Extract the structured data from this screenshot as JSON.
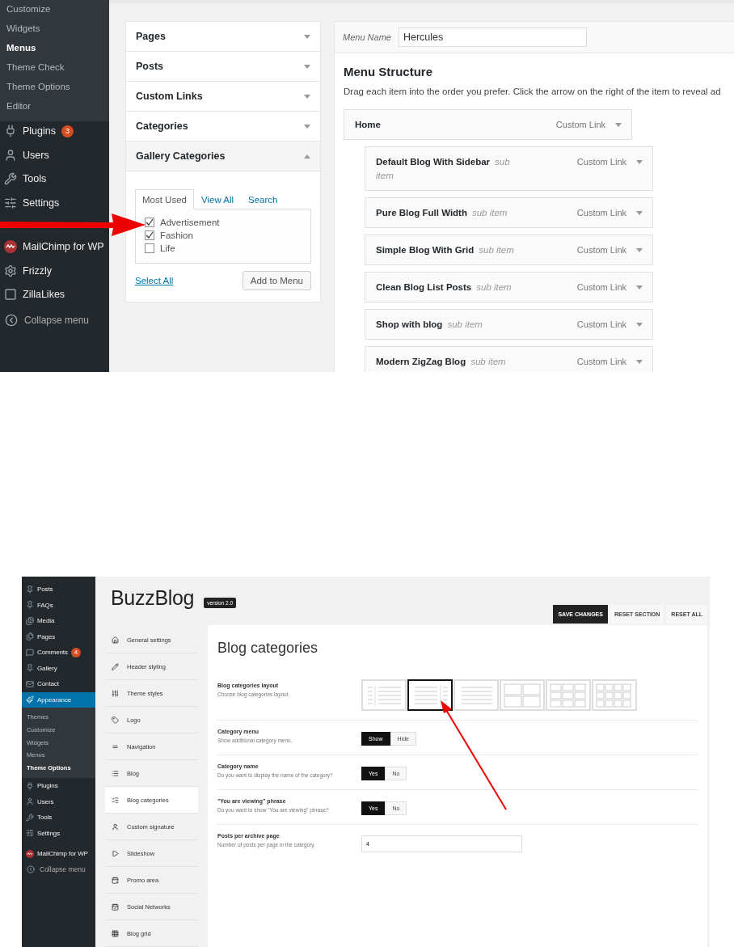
{
  "menus_screen": {
    "sidebar": {
      "submenu": [
        {
          "label": "Customize",
          "selected": false
        },
        {
          "label": "Widgets",
          "selected": false
        },
        {
          "label": "Menus",
          "selected": true
        },
        {
          "label": "Theme Check",
          "selected": false
        },
        {
          "label": "Theme Options",
          "selected": false
        },
        {
          "label": "Editor",
          "selected": false
        }
      ],
      "items": [
        {
          "label": "Plugins",
          "badge": "3"
        },
        {
          "label": "Users"
        },
        {
          "label": "Tools"
        },
        {
          "label": "Settings"
        },
        {
          "label": "MailChimp for WP"
        },
        {
          "label": "Frizzly"
        },
        {
          "label": "ZillaLikes"
        }
      ],
      "collapse": "Collapse menu"
    },
    "accordion": [
      {
        "title": "Pages",
        "expanded": false
      },
      {
        "title": "Posts",
        "expanded": false
      },
      {
        "title": "Custom Links",
        "expanded": false
      },
      {
        "title": "Categories",
        "expanded": false
      },
      {
        "title": "Gallery Categories",
        "expanded": true,
        "tabs": [
          {
            "label": "Most Used",
            "selected": true
          },
          {
            "label": "View All",
            "selected": false
          },
          {
            "label": "Search",
            "selected": false
          }
        ],
        "checklist": [
          {
            "label": "Advertisement",
            "checked": true
          },
          {
            "label": "Fashion",
            "checked": true
          },
          {
            "label": "Life",
            "checked": false
          }
        ],
        "select_all": "Select All",
        "add_button": "Add to Menu"
      }
    ],
    "menu_name": {
      "label": "Menu Name",
      "value": "Hercules"
    },
    "structure": {
      "title": "Menu Structure",
      "hint": "Drag each item into the order you prefer. Click the arrow on the right of the item to reveal ad",
      "items": [
        {
          "title": "Home",
          "type": "Custom Link",
          "children": [
            {
              "title": "Default Blog With Sidebar",
              "note": "sub item",
              "type": "Custom Link"
            },
            {
              "title": "Pure Blog Full Width",
              "note": "sub item",
              "type": "Custom Link"
            },
            {
              "title": "Simple Blog With Grid",
              "note": "sub item",
              "type": "Custom Link"
            },
            {
              "title": "Clean Blog List Posts",
              "note": "sub item",
              "type": "Custom Link"
            },
            {
              "title": "Shop with blog",
              "note": "sub item",
              "type": "Custom Link"
            },
            {
              "title": "Modern ZigZag Blog",
              "note": "sub item",
              "type": "Custom Link"
            }
          ]
        }
      ]
    }
  },
  "theme_options_screen": {
    "sidebar": {
      "items": [
        {
          "label": "Posts",
          "selected": false
        },
        {
          "label": "FAQs",
          "selected": false
        },
        {
          "label": "Media",
          "selected": false
        },
        {
          "label": "Pages",
          "selected": false
        },
        {
          "label": "Comments",
          "badge": "4",
          "selected": false
        },
        {
          "label": "Gallery",
          "selected": false
        },
        {
          "label": "Contact",
          "selected": false
        },
        {
          "label": "Appearance",
          "selected": true,
          "children": [
            {
              "label": "Themes",
              "selected": false
            },
            {
              "label": "Customize",
              "selected": false
            },
            {
              "label": "Widgets",
              "selected": false
            },
            {
              "label": "Menus",
              "selected": false
            },
            {
              "label": "Theme Options",
              "selected": true
            }
          ]
        },
        {
          "label": "Plugins",
          "selected": false
        },
        {
          "label": "Users",
          "selected": false
        },
        {
          "label": "Tools",
          "selected": false
        },
        {
          "label": "Settings",
          "selected": false
        },
        {
          "label": "MailChimp for WP",
          "selected": false
        }
      ],
      "collapse": "Collapse menu"
    },
    "logo": "BuzzBlog",
    "version": "version 2.0",
    "buttons": [
      {
        "label": "SAVE CHANGES",
        "kind": "primary"
      },
      {
        "label": "RESET SECTION",
        "kind": "plain"
      },
      {
        "label": "RESET ALL",
        "kind": "plain"
      }
    ],
    "nav": [
      {
        "label": "General settings",
        "selected": false
      },
      {
        "label": "Header styling",
        "selected": false
      },
      {
        "label": "Theme styles",
        "selected": false
      },
      {
        "label": "Logo",
        "selected": false
      },
      {
        "label": "Navigation",
        "selected": false
      },
      {
        "label": "Blog",
        "selected": false
      },
      {
        "label": "Blog categories",
        "selected": true
      },
      {
        "label": "Custom signature",
        "selected": false
      },
      {
        "label": "Slideshow",
        "selected": false
      },
      {
        "label": "Promo area",
        "selected": false
      },
      {
        "label": "Social Networks",
        "selected": false
      },
      {
        "label": "Blog grid",
        "selected": false
      }
    ],
    "section_title": "Blog categories",
    "settings": [
      {
        "kind": "layouts",
        "label": "Blog categories layout",
        "description": "Choose blog categories layout.",
        "options": [
          {
            "kind": "sidebar-left",
            "selected": false
          },
          {
            "kind": "sidebar-right",
            "selected": true
          },
          {
            "kind": "full",
            "selected": false
          },
          {
            "kind": "grid-2",
            "selected": false
          },
          {
            "kind": "grid-3",
            "selected": false
          },
          {
            "kind": "grid-4",
            "selected": false
          }
        ]
      },
      {
        "kind": "toggle",
        "label": "Category menu",
        "description": "Show additional category menu.",
        "options": [
          {
            "label": "Show",
            "selected": true
          },
          {
            "label": "Hide",
            "selected": false
          }
        ]
      },
      {
        "kind": "toggle",
        "label": "Category name",
        "description": "Do you want to display the name of the category?",
        "options": [
          {
            "label": "Yes",
            "selected": true
          },
          {
            "label": "No",
            "selected": false
          }
        ]
      },
      {
        "kind": "toggle",
        "label": "\"You are viewing\" phrase",
        "description": "Do you want to show \"You are viewing\" phrase?",
        "options": [
          {
            "label": "Yes",
            "selected": true
          },
          {
            "label": "No",
            "selected": false
          }
        ]
      },
      {
        "kind": "text",
        "label": "Posts per archive page",
        "description": "Number of posts per page in the category.",
        "value": "4"
      }
    ]
  }
}
